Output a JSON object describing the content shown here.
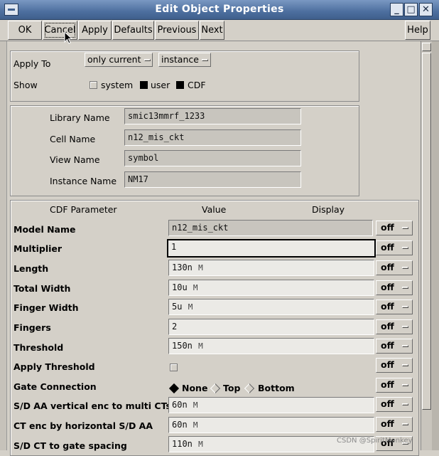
{
  "window": {
    "title": "Edit Object Properties",
    "controls": [
      "minimize-icon",
      "maximize-icon",
      "close-icon"
    ],
    "minimize_label": "_",
    "maximize_label": "□",
    "close_label": "✕"
  },
  "toolbar": {
    "ok": "OK",
    "cancel": "Cancel",
    "apply": "Apply",
    "defaults": "Defaults",
    "previous": "Previous",
    "next": "Next",
    "help": "Help"
  },
  "apply_section": {
    "apply_to_label": "Apply To",
    "apply_to_value": "only current",
    "apply_to_type": "instance",
    "show_label": "Show",
    "show_options": [
      {
        "label": "system",
        "checked": false
      },
      {
        "label": "user",
        "checked": true
      },
      {
        "label": "CDF",
        "checked": true
      }
    ]
  },
  "identity": {
    "library_label": "Library Name",
    "library_value": "smic13mmrf_1233",
    "cell_label": "Cell Name",
    "cell_value": "n12_mis_ckt",
    "view_label": "View Name",
    "view_value": "symbol",
    "instance_label": "Instance Name",
    "instance_value": "NM17"
  },
  "cdf": {
    "header_param": "CDF Parameter",
    "header_value": "Value",
    "header_display": "Display",
    "display_off": "off",
    "rows": [
      {
        "name": "Model Name",
        "value": "n12_mis_ckt",
        "unit": ""
      },
      {
        "name": "Multiplier",
        "value": "1",
        "unit": ""
      },
      {
        "name": "Length",
        "value": "130n",
        "unit": "M"
      },
      {
        "name": "Total Width",
        "value": "10u",
        "unit": "M"
      },
      {
        "name": "Finger Width",
        "value": "5u",
        "unit": "M"
      },
      {
        "name": "Fingers",
        "value": "2",
        "unit": ""
      },
      {
        "name": "Threshold",
        "value": "150n",
        "unit": "M"
      },
      {
        "name": "Apply Threshold",
        "value": "",
        "unit": ""
      },
      {
        "name": "Gate Connection",
        "value": "",
        "unit": ""
      },
      {
        "name": "S/D AA vertical enc to multi CTs",
        "value": "60n",
        "unit": "M"
      },
      {
        "name": "CT enc by horizontal S/D AA",
        "value": "60n",
        "unit": "M"
      },
      {
        "name": "S/D CT to gate spacing",
        "value": "110n",
        "unit": "M"
      }
    ],
    "gate_options": [
      {
        "label": "None",
        "selected": true
      },
      {
        "label": "Top",
        "selected": false
      },
      {
        "label": "Bottom",
        "selected": false
      }
    ]
  },
  "watermark": "CSDN @SpiritMonkey"
}
